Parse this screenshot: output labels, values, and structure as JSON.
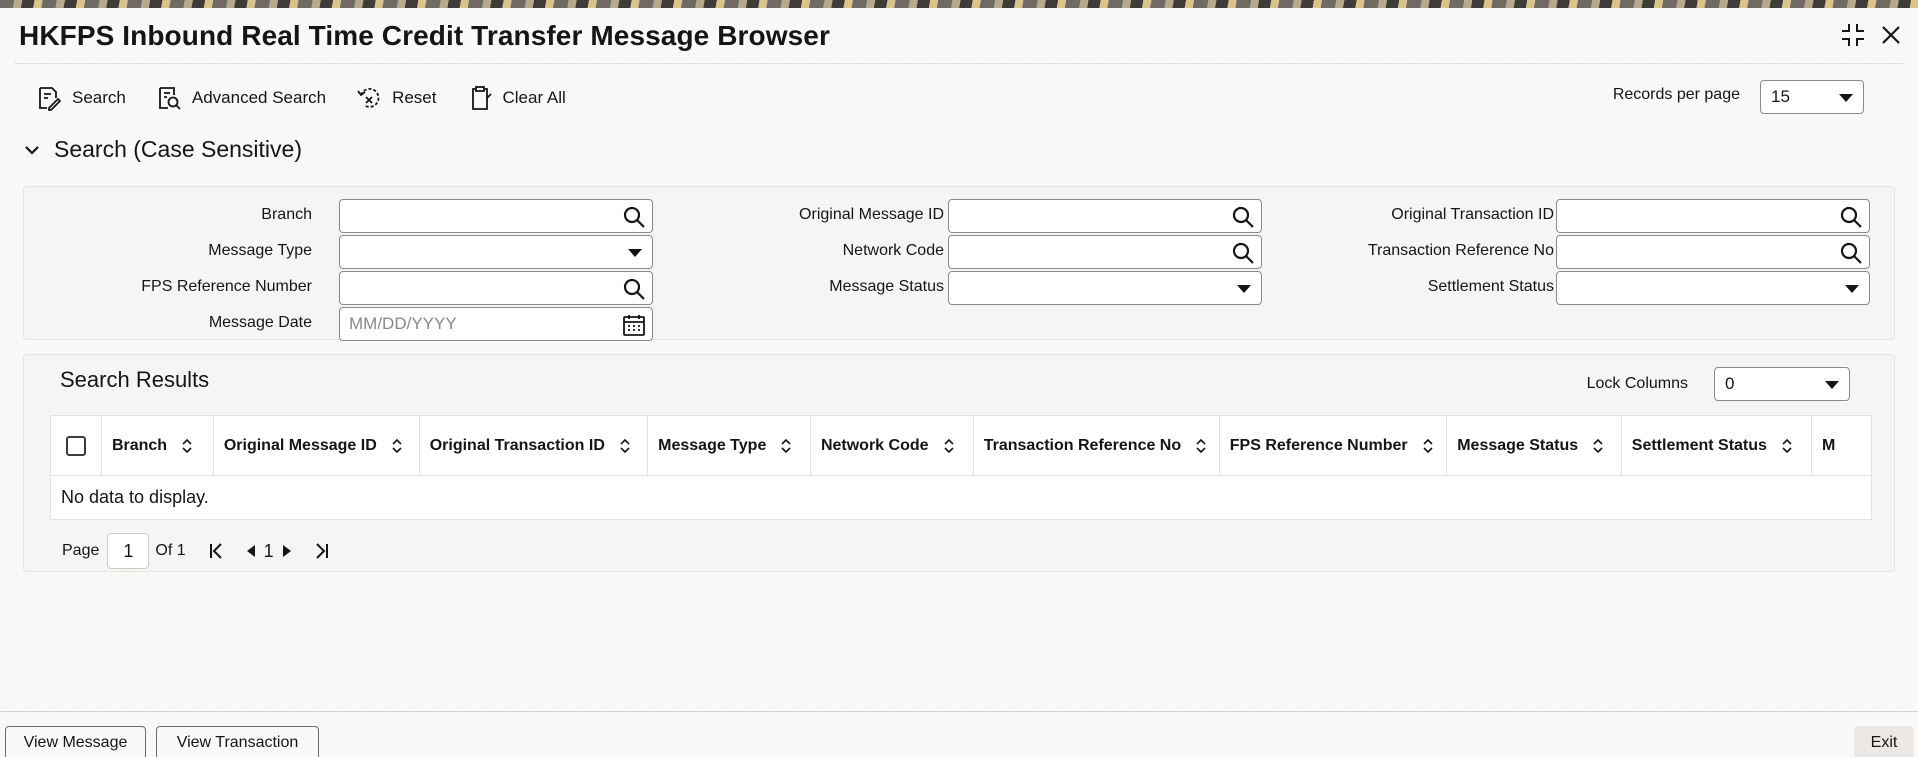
{
  "title": "HKFPS Inbound Real Time Credit Transfer Message Browser",
  "toolbar": {
    "search_label": "Search",
    "advanced_search_label": "Advanced Search",
    "reset_label": "Reset",
    "clear_all_label": "Clear All"
  },
  "records_per_page": {
    "label": "Records per page",
    "value": "15"
  },
  "search_section": {
    "title": "Search (Case Sensitive)"
  },
  "fields": {
    "branch": {
      "label": "Branch",
      "value": ""
    },
    "message_type": {
      "label": "Message Type",
      "value": ""
    },
    "fps_reference_number": {
      "label": "FPS Reference Number",
      "value": ""
    },
    "message_date": {
      "label": "Message Date",
      "placeholder": "MM/DD/YYYY"
    },
    "original_message_id": {
      "label": "Original Message ID",
      "value": ""
    },
    "network_code": {
      "label": "Network Code",
      "value": ""
    },
    "message_status": {
      "label": "Message Status",
      "value": ""
    },
    "original_transaction_id": {
      "label": "Original Transaction ID",
      "value": ""
    },
    "transaction_reference_no": {
      "label": "Transaction Reference No",
      "value": ""
    },
    "settlement_status": {
      "label": "Settlement Status",
      "value": ""
    }
  },
  "results": {
    "title": "Search Results",
    "lock_columns_label": "Lock Columns",
    "lock_columns_value": "0",
    "columns": [
      "Branch",
      "Original Message ID",
      "Original Transaction ID",
      "Message Type",
      "Network Code",
      "Transaction Reference No",
      "FPS Reference Number",
      "Message Status",
      "Settlement Status",
      "M"
    ],
    "empty_text": "No data to display."
  },
  "pagination": {
    "page_label": "Page",
    "page_value": "1",
    "of_label": "Of 1",
    "current_page": "1"
  },
  "footer": {
    "view_message_label": "View Message",
    "view_transaction_label": "View Transaction",
    "exit_label": "Exit"
  },
  "icons": {
    "collapse": "collapse-icon",
    "close": "close-icon",
    "search": "search-icon",
    "calendar": "calendar-icon",
    "sort": "sort-icon"
  }
}
